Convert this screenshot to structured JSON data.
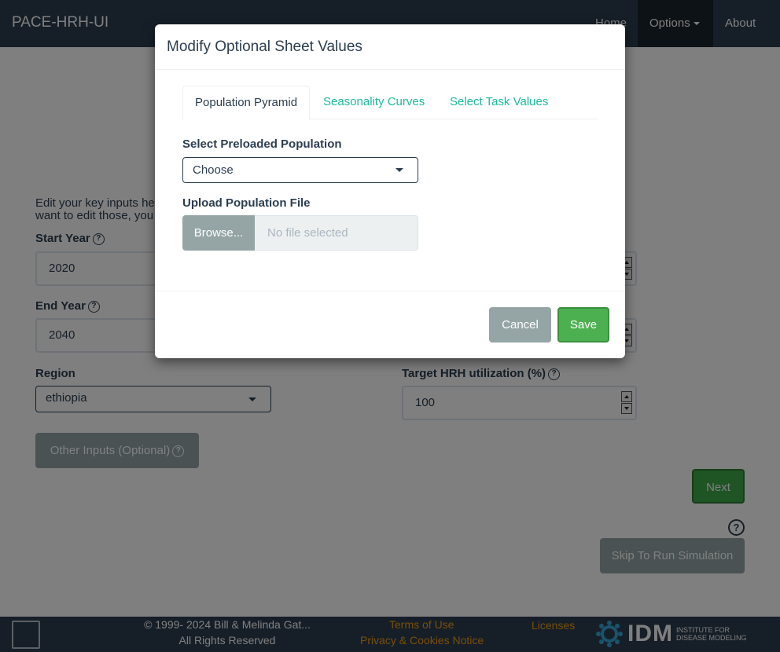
{
  "navbar": {
    "brand": "PACE-HRH-UI",
    "items": [
      {
        "label": "Home"
      },
      {
        "label": "Options"
      },
      {
        "label": "About"
      }
    ]
  },
  "form": {
    "intro_line1": "Edit your key inputs here. Default values are set for your region, but if you",
    "intro_line2": "want to edit those, you",
    "start_year": {
      "label": "Start Year",
      "value": "2020"
    },
    "end_year": {
      "label": "End Year",
      "value": "2040"
    },
    "region": {
      "label": "Region",
      "value": "ethiopia"
    },
    "target_hrh": {
      "label": "Target HRH utilization (%)",
      "value": "100"
    },
    "other_inputs_label": "Other Inputs (Optional)",
    "next_label": "Next",
    "skip_label": "Skip To Run Simulation"
  },
  "modal": {
    "title": "Modify Optional Sheet Values",
    "tabs": [
      {
        "label": "Population Pyramid",
        "active": true
      },
      {
        "label": "Seasonality Curves",
        "active": false
      },
      {
        "label": "Select Task Values",
        "active": false
      }
    ],
    "preloaded_label": "Select Preloaded Population",
    "preloaded_value": "Choose",
    "upload_label": "Upload Population File",
    "browse_label": "Browse...",
    "file_placeholder": "No file selected",
    "cancel_label": "Cancel",
    "save_label": "Save"
  },
  "footer": {
    "copyright": "© 1999- 2024 Bill & Melinda Gat...",
    "rights": "All Rights Reserved",
    "terms": "Terms of Use",
    "privacy": "Privacy & Cookies Notice",
    "licenses": "Licenses",
    "logo_text": "IDM",
    "logo_sub_1": "INSTITUTE FOR",
    "logo_sub_2": "DISEASE MODELING"
  },
  "colors": {
    "navbar": "#2c3e50",
    "accent": "#18bc9c",
    "link_footer": "#f39c12",
    "save": "#4cb050",
    "muted_button": "#95a5a6"
  }
}
